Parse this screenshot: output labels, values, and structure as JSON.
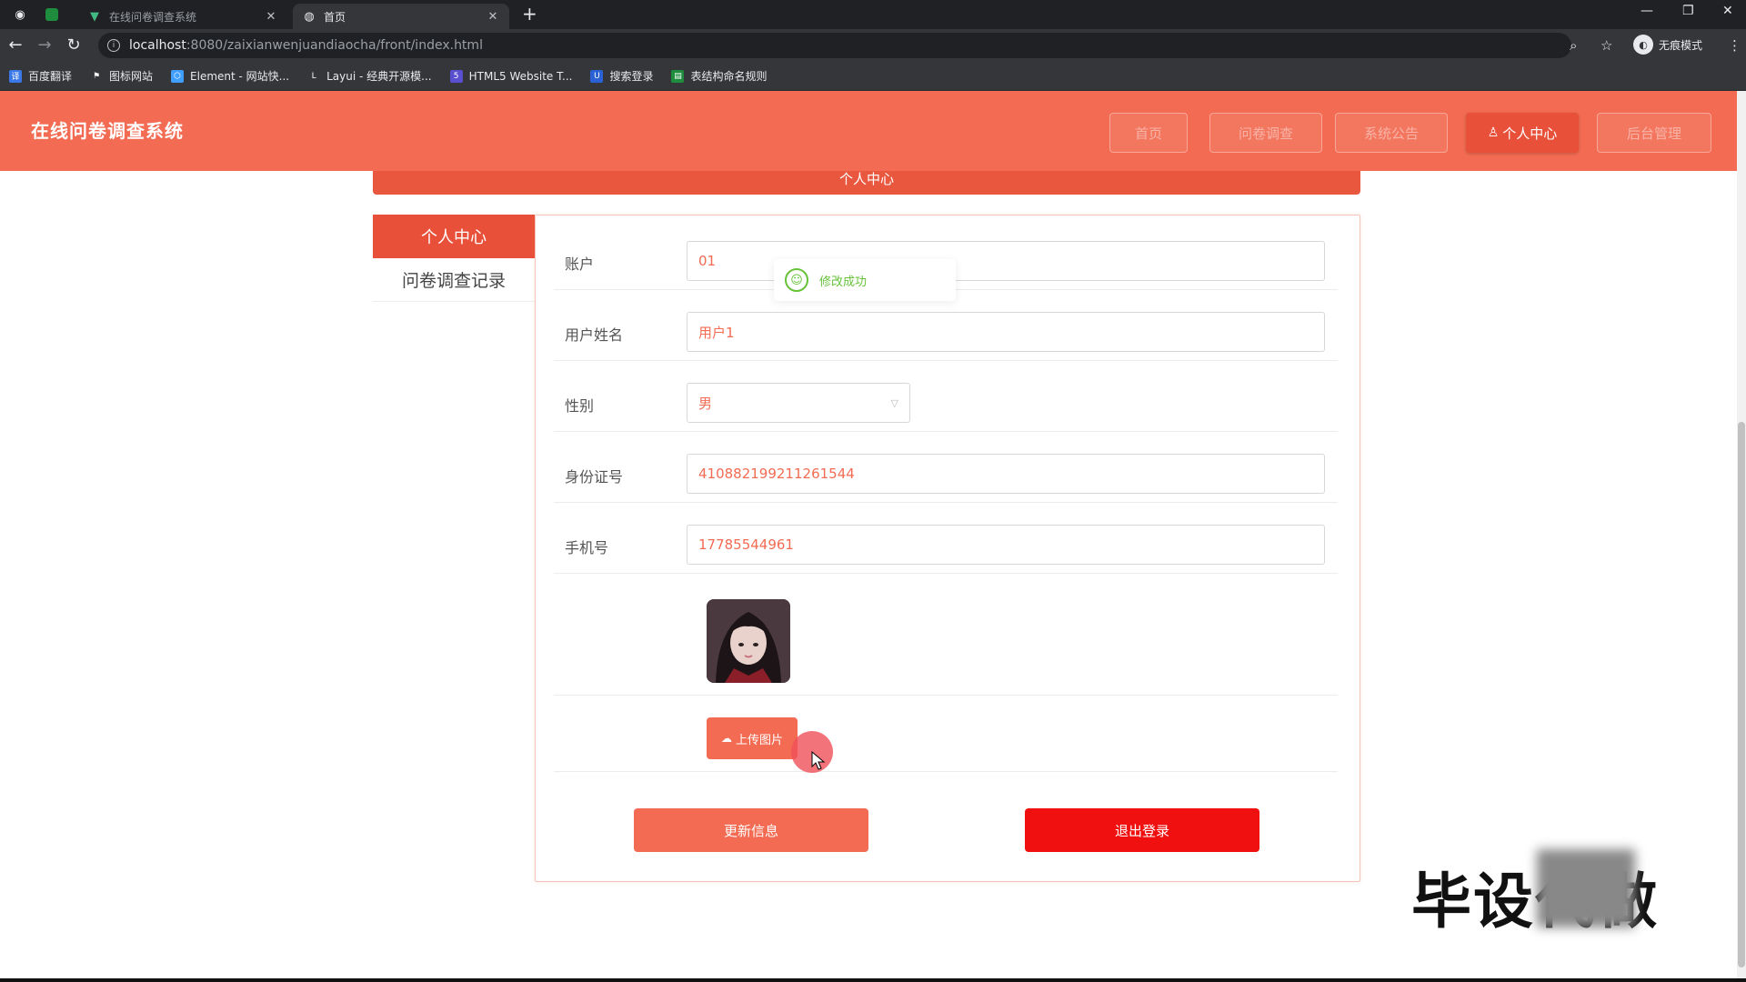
{
  "browser": {
    "tabs": [
      {
        "title": "在线问卷调查系统",
        "active": false
      },
      {
        "title": "首页",
        "active": true
      }
    ],
    "url_host": "localhost",
    "url_path": ":8080/zaixianwenjuandiaocha/front/index.html",
    "profile_label": "无痕模式",
    "bookmarks": [
      "百度翻译",
      "图标网站",
      "Element - 网站快...",
      "Layui - 经典开源模...",
      "HTML5 Website T...",
      "搜索登录",
      "表结构命名规则"
    ]
  },
  "header": {
    "brand": "在线问卷调查系统",
    "nav": [
      "首页",
      "问卷调查",
      "系统公告",
      "个人中心",
      "后台管理"
    ],
    "active_nav": "个人中心"
  },
  "section_title": "个人中心",
  "sidebar": {
    "items": [
      {
        "label": "个人中心",
        "active": true
      },
      {
        "label": "问卷调查记录",
        "active": false
      }
    ]
  },
  "form": {
    "account_label": "账户",
    "account_value": "01",
    "name_label": "用户姓名",
    "name_value": "用户1",
    "gender_label": "性别",
    "gender_value": "男",
    "id_label": "身份证号",
    "id_value": "410882199211261544",
    "phone_label": "手机号",
    "phone_value": "17785544961",
    "upload_label": "上传图片",
    "update_button": "更新信息",
    "logout_button": "退出登录"
  },
  "toast": {
    "message": "修改成功"
  },
  "watermark": "毕设代做",
  "colors": {
    "primary": "#f26b52",
    "active": "#e8503a",
    "danger": "#f01010",
    "success": "#67c23a"
  }
}
